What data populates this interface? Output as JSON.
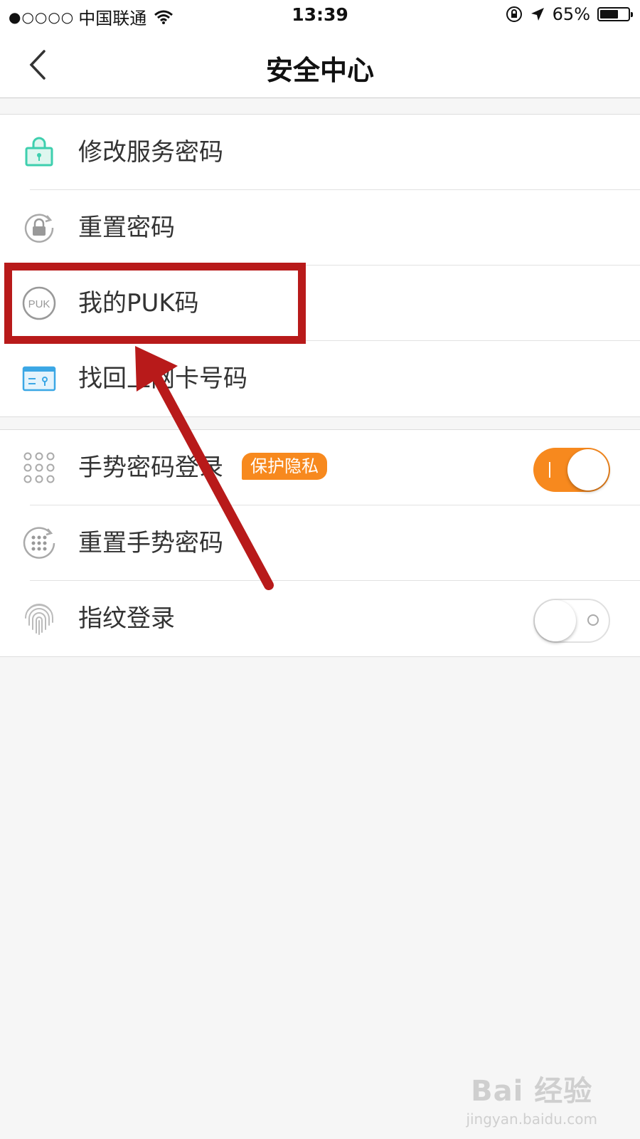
{
  "status_bar": {
    "signal": "●○○○○",
    "carrier": "中国联通",
    "time": "13:39",
    "battery_text": "65%",
    "battery_level": 0.65
  },
  "nav": {
    "title": "安全中心"
  },
  "group1": [
    {
      "label": "修改服务密码",
      "icon": "lock-icon"
    },
    {
      "label": "重置密码",
      "icon": "reset-lock-icon"
    },
    {
      "label": "我的PUK码",
      "icon": "puk-icon",
      "icon_text": "PUK"
    },
    {
      "label": "找回上网卡号码",
      "icon": "card-icon"
    }
  ],
  "group2": [
    {
      "label": "手势密码登录",
      "icon": "gesture-grid-icon",
      "badge": "保护隐私",
      "toggle": true
    },
    {
      "label": "重置手势密码",
      "icon": "gesture-reset-icon"
    },
    {
      "label": "指纹登录",
      "icon": "fingerprint-icon",
      "toggle": false
    }
  ],
  "colors": {
    "accent": "#f7891e",
    "annotation": "#b81a1a",
    "lock_icon": "#3ecfae",
    "card_icon": "#3ba7e5"
  },
  "watermark": {
    "logo": "Bai 经验",
    "url": "jingyan.baidu.com"
  }
}
